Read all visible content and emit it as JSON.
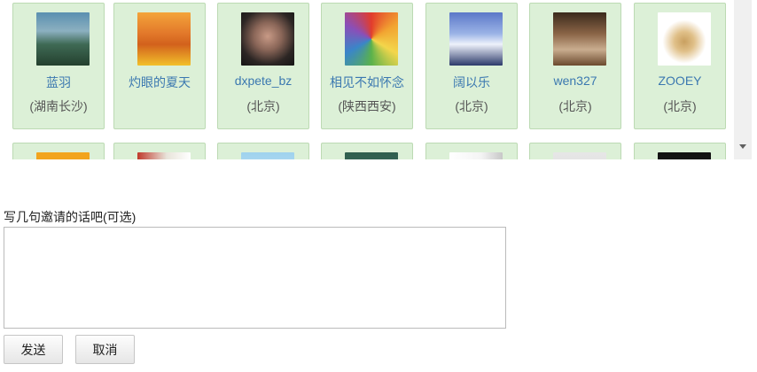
{
  "friends": [
    {
      "name": "蓝羽",
      "location": "(湖南长沙)",
      "avatar_bg": "linear-gradient(180deg,#5a8fb0 0%,#8cb0c0 35%,#3f6a55 60%,#24402e 100%)"
    },
    {
      "name": "灼眼的夏天",
      "location": "",
      "avatar_bg": "linear-gradient(180deg,#f4a43a 0%,#e2782a 40%,#d2611c 60%,#f2c02a 100%)"
    },
    {
      "name": "dxpete_bz",
      "location": "(北京)",
      "avatar_bg": "radial-gradient(circle at 50% 45%,#c89a86 0%,#8a6658 35%,#2c2624 70%,#151515 100%)"
    },
    {
      "name": "相见不如怀念",
      "location": "(陕西西安)",
      "avatar_bg": "conic-gradient(from 0deg at 50% 50%,#e23c2c,#f2a431,#f3d64b,#5ab24b,#3a86c8,#8a4fb8,#e23c2c)"
    },
    {
      "name": "阔以乐",
      "location": "(北京)",
      "avatar_bg": "linear-gradient(180deg,#5b78c8 0%,#9bb3e6 40%,#eef2fb 60%,#2c3a6a 100%)"
    },
    {
      "name": "wen327",
      "location": "(北京)",
      "avatar_bg": "linear-gradient(180deg,#3a2a1c 0%,#8a6446 40%,#c9ad8f 70%,#6b4a2e 100%)"
    },
    {
      "name": "ZOOEY",
      "location": "(北京)",
      "avatar_bg": "radial-gradient(circle at 50% 55%,#c9a060 0%,#e0c089 25%,#ffffff 55%,#ffffff 100%)"
    }
  ],
  "friends_row2": [
    {
      "avatar_bg": "linear-gradient(180deg,#f2a51e,#f09a13)"
    },
    {
      "avatar_bg": "linear-gradient(90deg,#c0392b 0%,#e8e4da 55%,#ffffff 100%)"
    },
    {
      "avatar_bg": "linear-gradient(180deg,#9fd2ee,#d4ecf8)"
    },
    {
      "avatar_bg": "linear-gradient(180deg,#2f5e4e,#4f7e6e)"
    },
    {
      "avatar_bg": "linear-gradient(90deg,#ffffff 0%,#f4f4f4 60%,#c7c7c7 100%)"
    },
    {
      "avatar_bg": "linear-gradient(180deg,#e6e6e6,#dcdcdc)"
    },
    {
      "avatar_bg": "linear-gradient(180deg,#111111,#2a2a2a)"
    }
  ],
  "invite": {
    "label": "写几句邀请的话吧(可选)",
    "value": "",
    "placeholder": ""
  },
  "buttons": {
    "send": "发送",
    "cancel": "取消"
  }
}
